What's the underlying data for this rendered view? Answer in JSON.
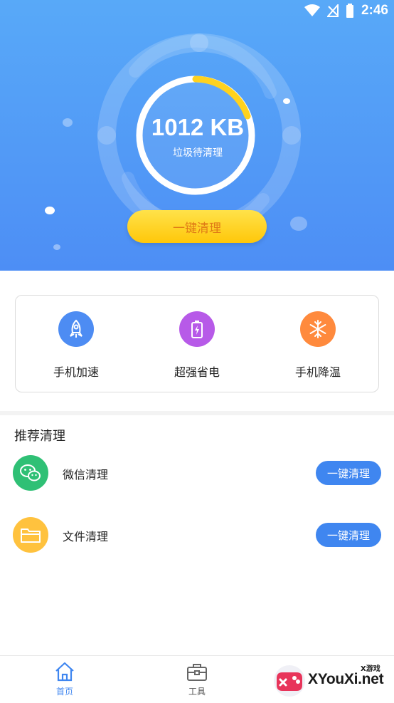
{
  "status_bar": {
    "time": "2:46"
  },
  "hero": {
    "value": "1012 KB",
    "label": "垃圾待清理",
    "button_label": "一键清理"
  },
  "tools": [
    {
      "label": "手机加速",
      "icon": "rocket-icon",
      "color": "#4d8cf3"
    },
    {
      "label": "超强省电",
      "icon": "battery-icon",
      "color": "#b75ae8"
    },
    {
      "label": "手机降温",
      "icon": "snowflake-icon",
      "color": "#ff8a3d"
    }
  ],
  "recommend": {
    "title": "推荐清理",
    "items": [
      {
        "name": "微信清理",
        "icon": "wechat-icon",
        "color": "#2fc075",
        "button_label": "一键清理"
      },
      {
        "name": "文件清理",
        "icon": "folder-icon",
        "color": "#ffc23e",
        "button_label": "一键清理"
      }
    ]
  },
  "nav": [
    {
      "label": "首页",
      "icon": "home-icon",
      "active": true
    },
    {
      "label": "工具",
      "icon": "toolbox-icon",
      "active": false
    }
  ],
  "watermark": {
    "brand": "XYouXi.net",
    "small": "X游戏"
  },
  "colors": {
    "primary": "#4d8ef5",
    "accent_yellow": "#ffd21e",
    "button_blue": "#3f86f0"
  }
}
